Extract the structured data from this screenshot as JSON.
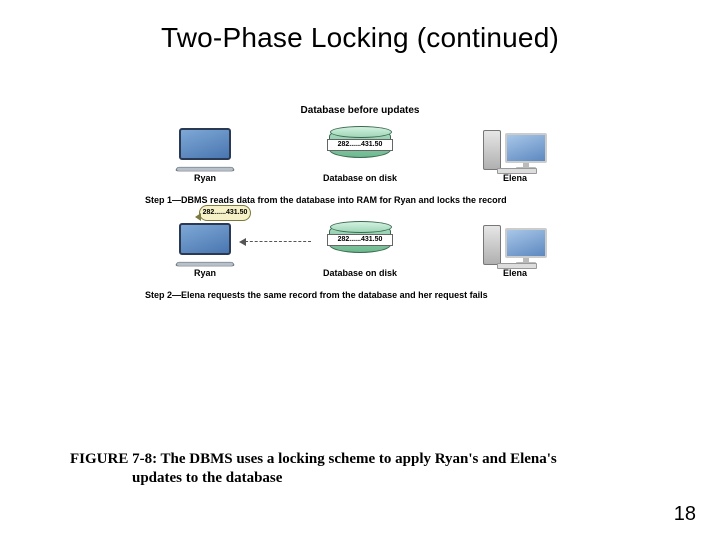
{
  "title": "Two-Phase Locking (continued)",
  "diagram": {
    "header0": "Database before updates",
    "ryan": "Ryan",
    "elena": "Elena",
    "db_on_disk": "Database on disk",
    "disk_value": "282......431.50",
    "bubble_value": "282......431.50",
    "step1": "Step 1—DBMS reads data from the database into RAM for Ryan and locks the record",
    "step2": "Step 2—Elena requests the same record from the database and her request fails"
  },
  "caption_line1": "FIGURE 7-8: The DBMS uses a locking scheme to apply Ryan's and Elena's",
  "caption_line2": "updates to the database",
  "page_number": "18"
}
